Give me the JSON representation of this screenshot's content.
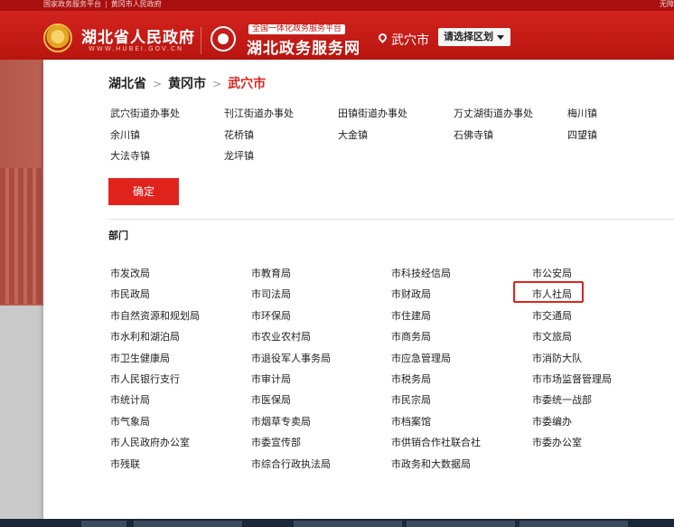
{
  "topbar": {
    "left_links": [
      "国家政务服务平台",
      "黄冈市人民政府"
    ],
    "right_text": "无障"
  },
  "header": {
    "site_name": "湖北省人民政府",
    "site_sub": "WWW.HUBEI.GOV.CN",
    "platform_tag": "全国一体化政务服务平台",
    "platform_name": "湖北政务服务网",
    "location": "武穴市",
    "region_select": "请选择区划"
  },
  "breadcrumb": {
    "province": "湖北省",
    "city": "黄冈市",
    "current": "武穴市",
    "sep": ">"
  },
  "towns": [
    "武穴街道办事处",
    "刊江街道办事处",
    "田镇街道办事处",
    "万丈湖街道办事处",
    "梅川镇",
    "余川镇",
    "花桥镇",
    "大金镇",
    "石佛寺镇",
    "四望镇",
    "大法寺镇",
    "龙坪镇"
  ],
  "confirm_label": "确定",
  "dept_title": "部门",
  "departments": [
    "市发改局",
    "市教育局",
    "市科技经信局",
    "市公安局",
    "市民政局",
    "市司法局",
    "市财政局",
    "市人社局",
    "市自然资源和规划局",
    "市环保局",
    "市住建局",
    "市交通局",
    "市水利和湖泊局",
    "市农业农村局",
    "市商务局",
    "市文旅局",
    "市卫生健康局",
    "市退役军人事务局",
    "市应急管理局",
    "市消防大队",
    "市人民银行支行",
    "市审计局",
    "市税务局",
    "市市场监督管理局",
    "市统计局",
    "市医保局",
    "市民宗局",
    "市委统一战部",
    "市气象局",
    "市烟草专卖局",
    "市档案馆",
    "市委编办",
    "市人民政府办公室",
    "市委宣传部",
    "市供销合作社联合社",
    "市委办公室",
    "市残联",
    "市综合行政执法局",
    "市政务和大数据局"
  ],
  "highlighted_department": "市人社局",
  "colors": {
    "brand_red": "#d3231e",
    "accent_red": "#e0231c",
    "current_crumb": "#d7251f"
  }
}
